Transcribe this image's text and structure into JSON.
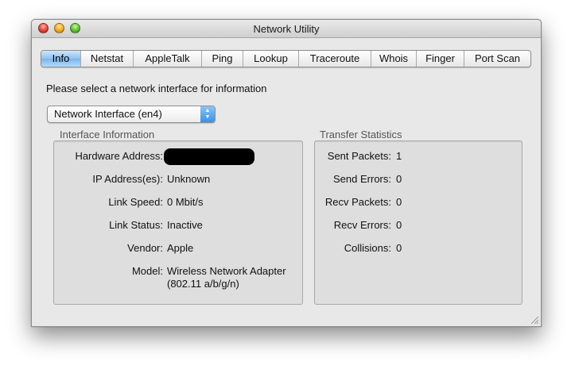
{
  "window": {
    "title": "Network Utility"
  },
  "tabs": [
    "Info",
    "Netstat",
    "AppleTalk",
    "Ping",
    "Lookup",
    "Traceroute",
    "Whois",
    "Finger",
    "Port Scan"
  ],
  "active_tab": "Info",
  "prompt": "Please select a network interface for information",
  "interface_select": {
    "value": "Network Interface (en4)"
  },
  "interface_info": {
    "title": "Interface Information",
    "rows": [
      {
        "label": "Hardware Address:",
        "value": ""
      },
      {
        "label": "IP Address(es):",
        "value": "Unknown"
      },
      {
        "label": "Link Speed:",
        "value": "0 Mbit/s"
      },
      {
        "label": "Link Status:",
        "value": "Inactive"
      },
      {
        "label": "Vendor:",
        "value": "Apple"
      },
      {
        "label": "Model:",
        "value": "Wireless Network Adapter",
        "value2": "(802.11 a/b/g/n)"
      }
    ]
  },
  "transfer_stats": {
    "title": "Transfer Statistics",
    "rows": [
      {
        "label": "Sent Packets:",
        "value": "1"
      },
      {
        "label": "Send Errors:",
        "value": "0"
      },
      {
        "label": "Recv Packets:",
        "value": "0"
      },
      {
        "label": "Recv Errors:",
        "value": "0"
      },
      {
        "label": "Collisions:",
        "value": "0"
      }
    ]
  },
  "icons": [
    "close-button-icon",
    "minimize-button-icon",
    "zoom-button-icon",
    "popup-arrows-icon",
    "resize-grip-icon"
  ],
  "colors": {
    "active_tab": "#7bb5ec",
    "select_arrows": "#3d8fe0",
    "window_bg": "#e8e8e8"
  }
}
